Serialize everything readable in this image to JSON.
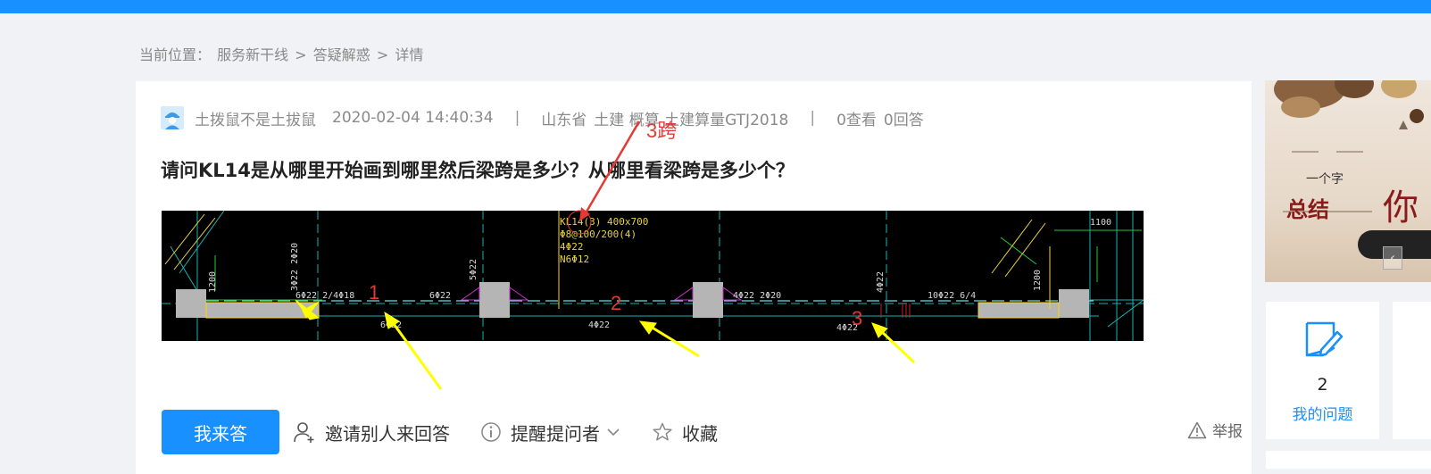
{
  "breadcrumb": {
    "prefix": "当前位置：",
    "items": [
      "服务新干线",
      ">",
      "答疑解惑",
      ">",
      "详情"
    ]
  },
  "post": {
    "author": "土拨鼠不是土拔鼠",
    "datetime": "2020-02-04 14:40:34",
    "separator": "|",
    "province": "山东省",
    "tags": "土建 概算 土建算量GTJ2018",
    "views": "0查看",
    "answers": "0回答",
    "question": "请问KL14是从哪里开始画到哪里然后梁跨是多少？从哪里看梁跨是多少个？"
  },
  "drawing": {
    "annotation_top": "3跨",
    "span_labels": [
      "1",
      "2",
      "3"
    ],
    "beam_note": [
      "KL14(3) 400x700",
      "Φ8@100/200(4)",
      "4Φ22",
      "N6Φ12"
    ],
    "rebar_texts": [
      "6Φ22 2/4Φ18",
      "6Φ22",
      "4Φ22 2Φ20",
      "10Φ22 6/4",
      "4Φ22",
      "4Φ22",
      "4Φ22",
      "6Φ22",
      "1100",
      "1200",
      "1200",
      "5Φ22",
      "3Φ22 2Φ20"
    ]
  },
  "actions": {
    "answer": "我来答",
    "invite": "邀请别人来回答",
    "remind": "提醒提问者",
    "favorite": "收藏",
    "report": "举报"
  },
  "banner": {
    "small_text": "一个字",
    "title": "总结",
    "big_char": "你"
  },
  "sidebar": {
    "my_questions_count": "2",
    "my_questions_label": "我的问题"
  },
  "colors": {
    "primary": "#1890ff",
    "annotation_red": "#e53935",
    "arrow_yellow": "#ffff00"
  }
}
